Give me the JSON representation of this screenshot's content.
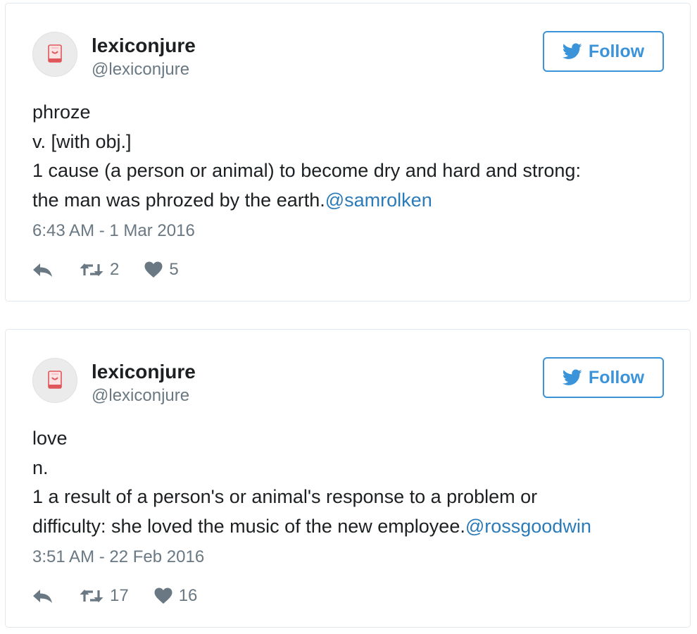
{
  "colors": {
    "accent": "#3b94d9",
    "mention": "#2b7bb9",
    "muted": "#697882",
    "text": "#1c2022",
    "border": "#e1e8ed",
    "avatar_icon": "#e0575b"
  },
  "tweets": [
    {
      "author": {
        "name": "lexiconjure",
        "handle": "@lexiconjure",
        "avatar_icon": "dictionary-icon"
      },
      "follow_label": "Follow",
      "body": {
        "word": "phroze",
        "pos": "v. [with obj.]",
        "definition": "1 cause (a person or animal) to become dry and hard and strong:",
        "example": "the man was phrozed by the earth.",
        "mention": "@samrolken"
      },
      "timestamp": "6:43 AM - 1 Mar 2016",
      "retweets": "2",
      "likes": "5"
    },
    {
      "author": {
        "name": "lexiconjure",
        "handle": "@lexiconjure",
        "avatar_icon": "dictionary-icon"
      },
      "follow_label": "Follow",
      "body": {
        "word": "love",
        "pos": "n.",
        "definition": "1 a result of a person's or animal's response to a problem or",
        "example": "difficulty: she loved the music of the new employee.",
        "mention": "@rossgoodwin"
      },
      "timestamp": "3:51 AM - 22 Feb 2016",
      "retweets": "17",
      "likes": "16"
    }
  ]
}
